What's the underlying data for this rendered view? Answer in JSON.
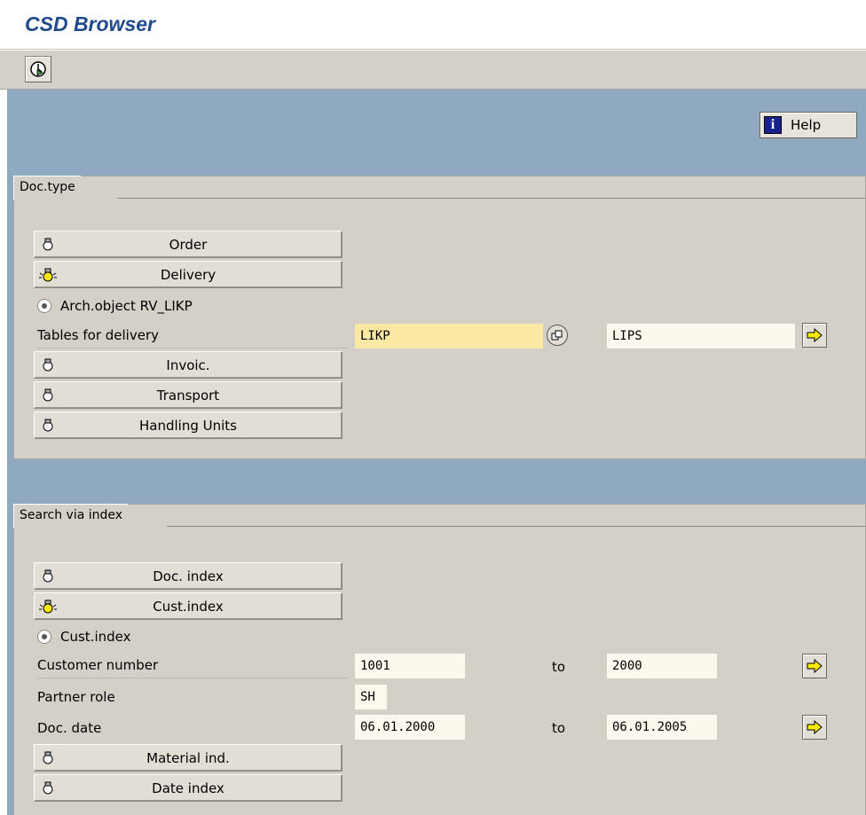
{
  "window": {
    "title": "CSD Browser"
  },
  "toolbar": {
    "execute_icon": "execute-icon"
  },
  "help": {
    "label": "Help",
    "icon": "info-icon"
  },
  "doctype": {
    "tab_label": "Doc.type",
    "buttons": [
      {
        "label": "Order",
        "icon": "lightbulb-off-icon"
      },
      {
        "label": "Delivery",
        "icon": "lightbulb-on-icon"
      }
    ],
    "radio_label": "Arch.object RV_LIKP",
    "tables_label": "Tables for delivery",
    "table_from": "LIKP",
    "table_to": "LIPS",
    "buttons2": [
      {
        "label": "Invoic.",
        "icon": "lightbulb-off-icon"
      },
      {
        "label": "Transport",
        "icon": "lightbulb-off-icon"
      },
      {
        "label": "Handling Units",
        "icon": "lightbulb-off-icon"
      }
    ]
  },
  "search": {
    "tab_label": "Search via index",
    "buttons": [
      {
        "label": "Doc. index",
        "icon": "lightbulb-off-icon"
      },
      {
        "label": "Cust.index",
        "icon": "lightbulb-on-icon"
      }
    ],
    "radio_label": "Cust.index",
    "customer_label": "Customer number",
    "customer_from": "1001",
    "customer_to": "2000",
    "to_label": "to",
    "partner_label": "Partner role",
    "partner_value": "SH",
    "docdate_label": "Doc. date",
    "docdate_from": "06.01.2000",
    "docdate_to": "06.01.2005",
    "buttons2": [
      {
        "label": "Material ind.",
        "icon": "lightbulb-off-icon"
      },
      {
        "label": "Date index",
        "icon": "lightbulb-off-icon"
      }
    ]
  },
  "colors": {
    "title": "#1f4a8c",
    "background_blue": "#8faac0",
    "panel": "#d4d0c8",
    "field_yellow": "#fbe8a3"
  }
}
